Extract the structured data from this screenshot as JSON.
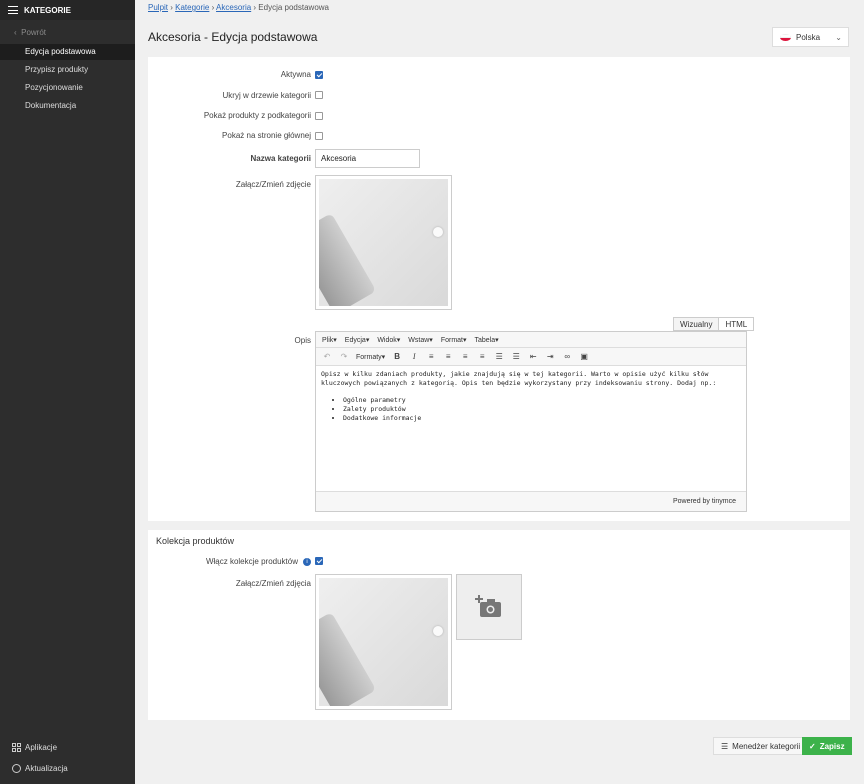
{
  "sidebar": {
    "title": "KATEGORIE",
    "back": "Powrót",
    "items": [
      {
        "label": "Edycja podstawowa",
        "active": true
      },
      {
        "label": "Przypisz produkty",
        "active": false
      },
      {
        "label": "Pozycjonowanie",
        "active": false
      },
      {
        "label": "Dokumentacja",
        "active": false
      }
    ],
    "bottom": {
      "apps": "Aplikacje",
      "updates": "Aktualizacja"
    }
  },
  "breadcrumb": {
    "items": [
      "Pulpit",
      "Kategorie",
      "Akcesoria"
    ],
    "current": "Edycja podstawowa"
  },
  "page_title": "Akcesoria - Edycja podstawowa",
  "language": {
    "label": "Polska",
    "colors": [
      "#ffffff",
      "#dc143c"
    ]
  },
  "form": {
    "active_label": "Aktywna",
    "active": true,
    "hide_label": "Ukryj w drzewie kategorii",
    "hide": false,
    "show_sub_label": "Pokaż produkty z podkategorii",
    "show_sub": false,
    "homepage_label": "Pokaż na stronie głównej",
    "homepage": false,
    "name_label": "Nazwa kategorii",
    "name_value": "Akcesoria",
    "image_label": "Załącz/Zmień zdjęcie",
    "desc_label": "Opis"
  },
  "editor": {
    "tab_visual": "Wizualny",
    "tab_html": "HTML",
    "menus": [
      "Plik",
      "Edycja",
      "Widok",
      "Wstaw",
      "Format",
      "Tabela"
    ],
    "formats": "Formaty",
    "text": "Opisz w kilku zdaniach produkty, jakie znajdują się w tej kategorii. Warto w opisie użyć kilku słów kluczowych powiązanych z kategorią. Opis ten będzie wykorzystany przy indeksowaniu strony. Dodaj np.:",
    "bullets": [
      "Ogólne parametry",
      "Zalety produktów",
      "Dodatkowe informacje"
    ],
    "powered": "Powered by tinymce"
  },
  "collection": {
    "title": "Kolekcja produktów",
    "enable_label": "Włącz kolekcje produktów",
    "enabled": true,
    "images_label": "Załącz/Zmień zdjęcia"
  },
  "buttons": {
    "manager": "Menedżer kategorii",
    "save": "Zapisz"
  },
  "colors": {
    "accent": "#2a67b8",
    "save": "#3cb24a",
    "sidebar": "#2d2d2d"
  }
}
